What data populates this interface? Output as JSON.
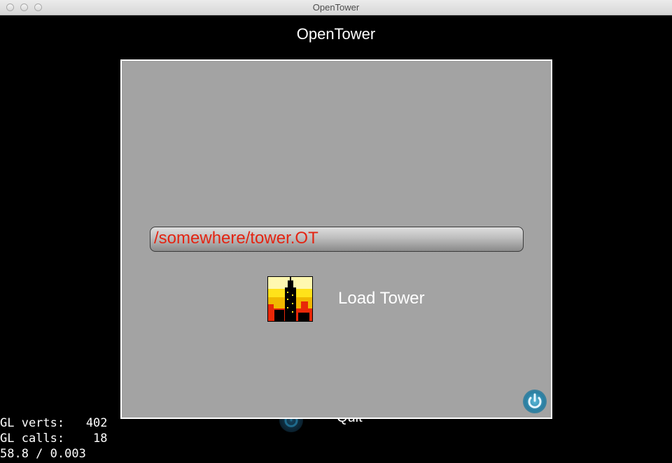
{
  "window": {
    "title": "OpenTower"
  },
  "app": {
    "title": "OpenTower"
  },
  "background": {
    "quit_label": "Quit"
  },
  "dialog": {
    "path_value": "/somewhere/tower.OT",
    "load_label": "Load Tower"
  },
  "debug": {
    "line1": "GL verts:   402",
    "line2": "GL calls:    18",
    "line3": "58.8 / 0.003"
  },
  "colors": {
    "dialog_bg": "#a3a3a3",
    "path_text": "#e32412",
    "power_glow": "#2a9fd0"
  },
  "icons": {
    "tower": "tower-icon",
    "power": "power-icon"
  }
}
